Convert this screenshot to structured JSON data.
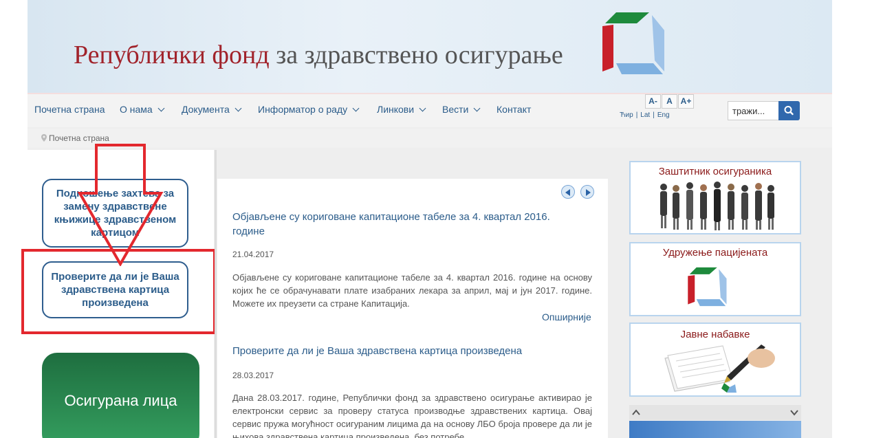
{
  "header": {
    "title_part1": "Републички фонд",
    "title_part2": "за здравствено осигурање"
  },
  "nav": {
    "items": [
      {
        "label": "Почетна страна",
        "dropdown": false
      },
      {
        "label": "О нама",
        "dropdown": true
      },
      {
        "label": "Документа",
        "dropdown": true
      },
      {
        "label": "Информатор о раду",
        "dropdown": true
      },
      {
        "label": "Линкови",
        "dropdown": true
      },
      {
        "label": "Вести",
        "dropdown": true
      },
      {
        "label": "Контакт",
        "dropdown": false
      }
    ],
    "font_controls": [
      "A-",
      "A",
      "A+"
    ],
    "languages": [
      "Ћир",
      "Lat",
      "Eng"
    ],
    "lang_separator": "|",
    "search_placeholder": "тражи..."
  },
  "breadcrumb": {
    "current": "Почетна страна"
  },
  "left": {
    "card1": "Подношење захтева за замену здравствене књижице здравственом картицом",
    "card2": "Проверите да ли је Ваша здравствена картица произведена",
    "card3": "Осигурана лица"
  },
  "news": [
    {
      "title": "Објављене су кориговане капитационе табеле за 4. квартал 2016. године",
      "date": "21.04.2017",
      "body": "Објављене су кориговане капитационе табеле за 4. квартал 2016. године на основу којих ће се обрачунавати плате изабраних лекара за април, мај и јун 2017. године. Можете их преузети са стране Капитација.",
      "more": "Опширније"
    },
    {
      "title": "Проверите да ли је Ваша здравствена картица произведена",
      "date": "28.03.2017",
      "body": "Дана 28.03.2017. године, Републички фонд за здравствено осигурање активирао је електронски сервис за проверу статуса производње здравствених картица. Овај сервис пружа могућност осигураним лицима да на основу ЛБО броја провере да ли је њихова здравствена картица произведена, без потребе"
    }
  ],
  "right": {
    "widget1": "Заштитник осигураника",
    "widget2": "Удружење пацијената",
    "widget3": "Јавне набавке"
  },
  "colors": {
    "brand_red": "#a1232b",
    "link_blue": "#2b5c8a",
    "highlight_red": "#e3282e",
    "green": "#2a8a52"
  }
}
